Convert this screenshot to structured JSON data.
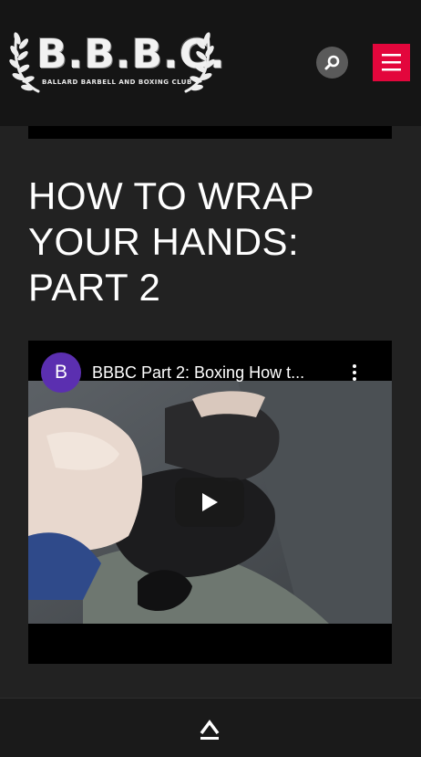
{
  "header": {
    "logo_text": "B.B.B.C.",
    "logo_subtext": "BALLARD BARBELL AND BOXING CLUB"
  },
  "post": {
    "title": "HOW TO WRAP YOUR HANDS: PART 2"
  },
  "video": {
    "channel_initial": "B",
    "title": "BBBC Part 2: Boxing How t..."
  },
  "icons": {
    "search": "search-icon",
    "menu": "hamburger-menu-icon",
    "more": "more-vertical-icon",
    "play": "play-icon",
    "back_to_top": "chevron-up-icon"
  },
  "colors": {
    "page_background": "#222222",
    "header_background": "#151515",
    "accent": "#e3063c",
    "avatar": "#5b2fb0"
  }
}
